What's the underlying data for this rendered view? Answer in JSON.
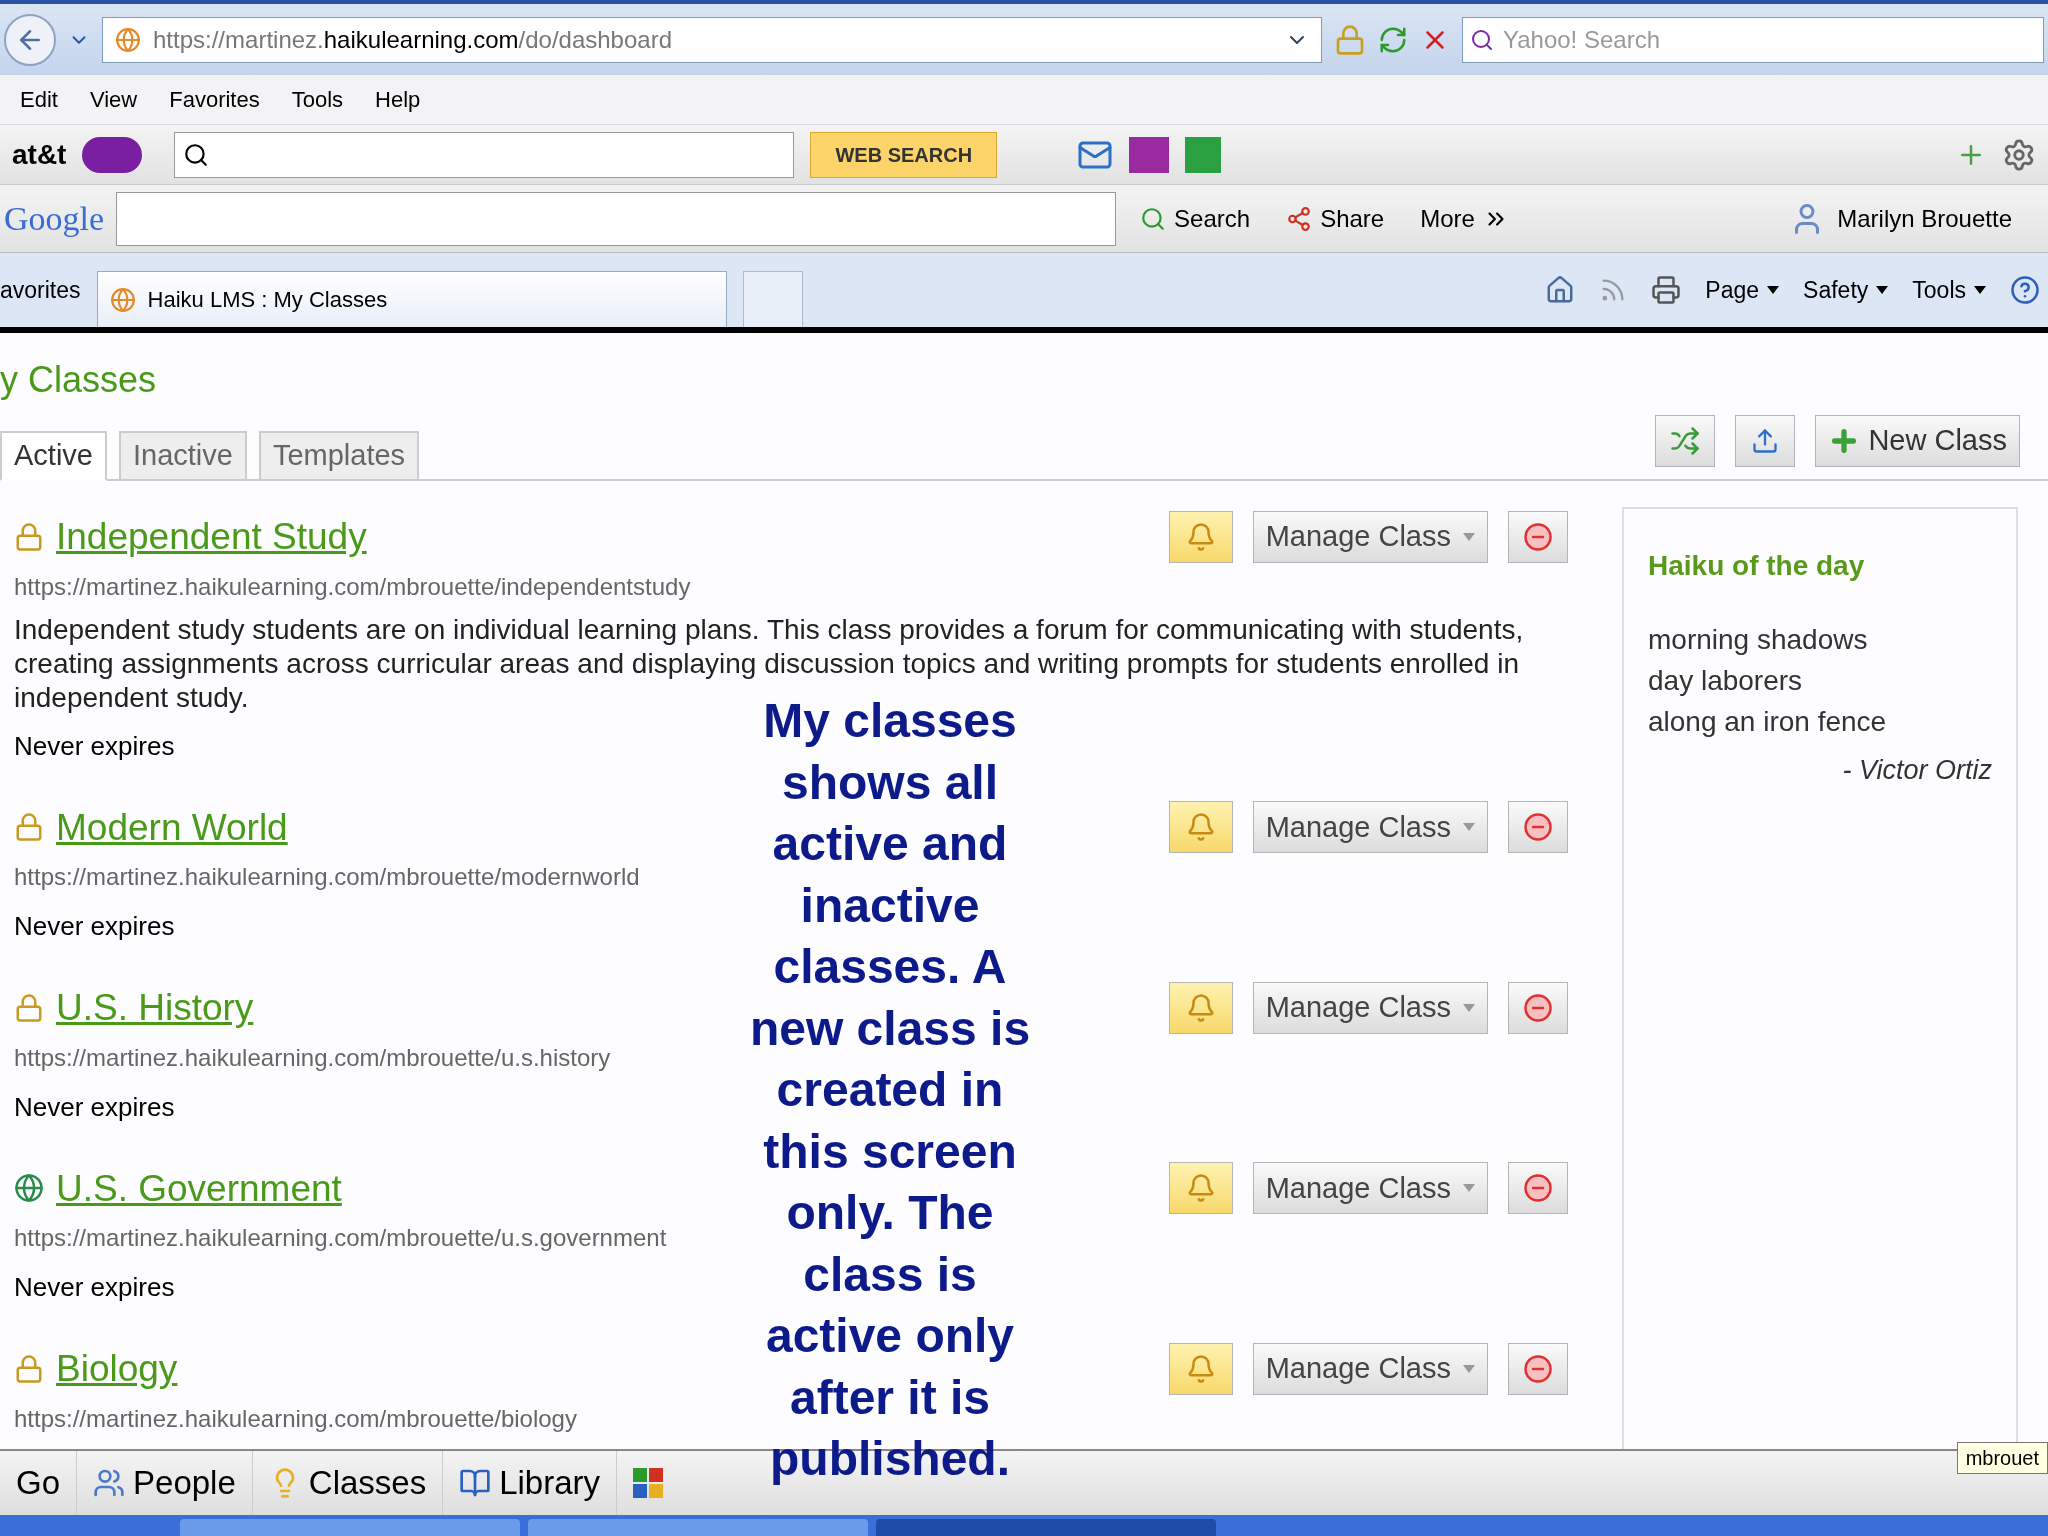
{
  "address_bar": {
    "segments": [
      {
        "text": "https://",
        "emphasis": false
      },
      {
        "text": "martinez.",
        "emphasis": false
      },
      {
        "text": "haikulearning.com",
        "emphasis": true
      },
      {
        "text": "/do/dashboard",
        "emphasis": false
      }
    ]
  },
  "search_box": {
    "placeholder": "Yahoo! Search"
  },
  "menu": [
    "Edit",
    "View",
    "Favorites",
    "Tools",
    "Help"
  ],
  "yahoo_toolbar": {
    "brand": "at&t",
    "search_button": "WEB SEARCH"
  },
  "google_toolbar": {
    "brand": "Google",
    "buttons": [
      "Search",
      "Share",
      "More"
    ],
    "user": "Marilyn Brouette"
  },
  "favorites_bar": {
    "label": "avorites",
    "tabs": [
      {
        "title": "Haiku LMS : My Classes",
        "selected": true
      },
      {
        "selected": false
      }
    ],
    "commands": [
      "Page",
      "Safety",
      "Tools"
    ]
  },
  "page": {
    "title": "y Classes",
    "tabs": [
      {
        "label": "Active",
        "selected": true
      },
      {
        "label": "Inactive",
        "selected": false
      },
      {
        "label": "Templates",
        "selected": false
      }
    ],
    "new_class_button": "New Class",
    "classes": [
      {
        "kind": "locked",
        "title": "Independent Study",
        "url": "https://martinez.haikulearning.com/mbrouette/independentstudy",
        "description": "Independent study students are on individual learning plans. This class provides a forum for communicating with students, creating assignments across curricular areas and displaying discussion topics and writing prompts for students enrolled in independent study.",
        "expiry": "Never expires",
        "manage": "Manage Class"
      },
      {
        "kind": "locked",
        "title": "Modern World",
        "url": "https://martinez.haikulearning.com/mbrouette/modernworld",
        "expiry": "Never expires",
        "manage": "Manage Class"
      },
      {
        "kind": "locked",
        "title": "U.S. History",
        "url": "https://martinez.haikulearning.com/mbrouette/u.s.history",
        "expiry": "Never expires",
        "manage": "Manage Class"
      },
      {
        "kind": "public",
        "title": "U.S. Government",
        "url": "https://martinez.haikulearning.com/mbrouette/u.s.government",
        "expiry": "Never expires",
        "manage": "Manage Class"
      },
      {
        "kind": "locked",
        "title": "Biology",
        "url": "https://martinez.haikulearning.com/mbrouette/biology",
        "manage": "Manage Class"
      }
    ],
    "haiku": {
      "heading": "Haiku of the day",
      "lines": [
        "morning shadows",
        "day laborers",
        "along an iron fence"
      ],
      "author": "- Victor Ortiz"
    }
  },
  "annotation": "My classes shows all active and inactive classes.  A new class is created in this screen only.  The class is active only after it is published.",
  "bottom_bar": {
    "items": [
      "Go",
      "People",
      "Classes",
      "Library"
    ]
  },
  "tooltip": "mbrouet"
}
